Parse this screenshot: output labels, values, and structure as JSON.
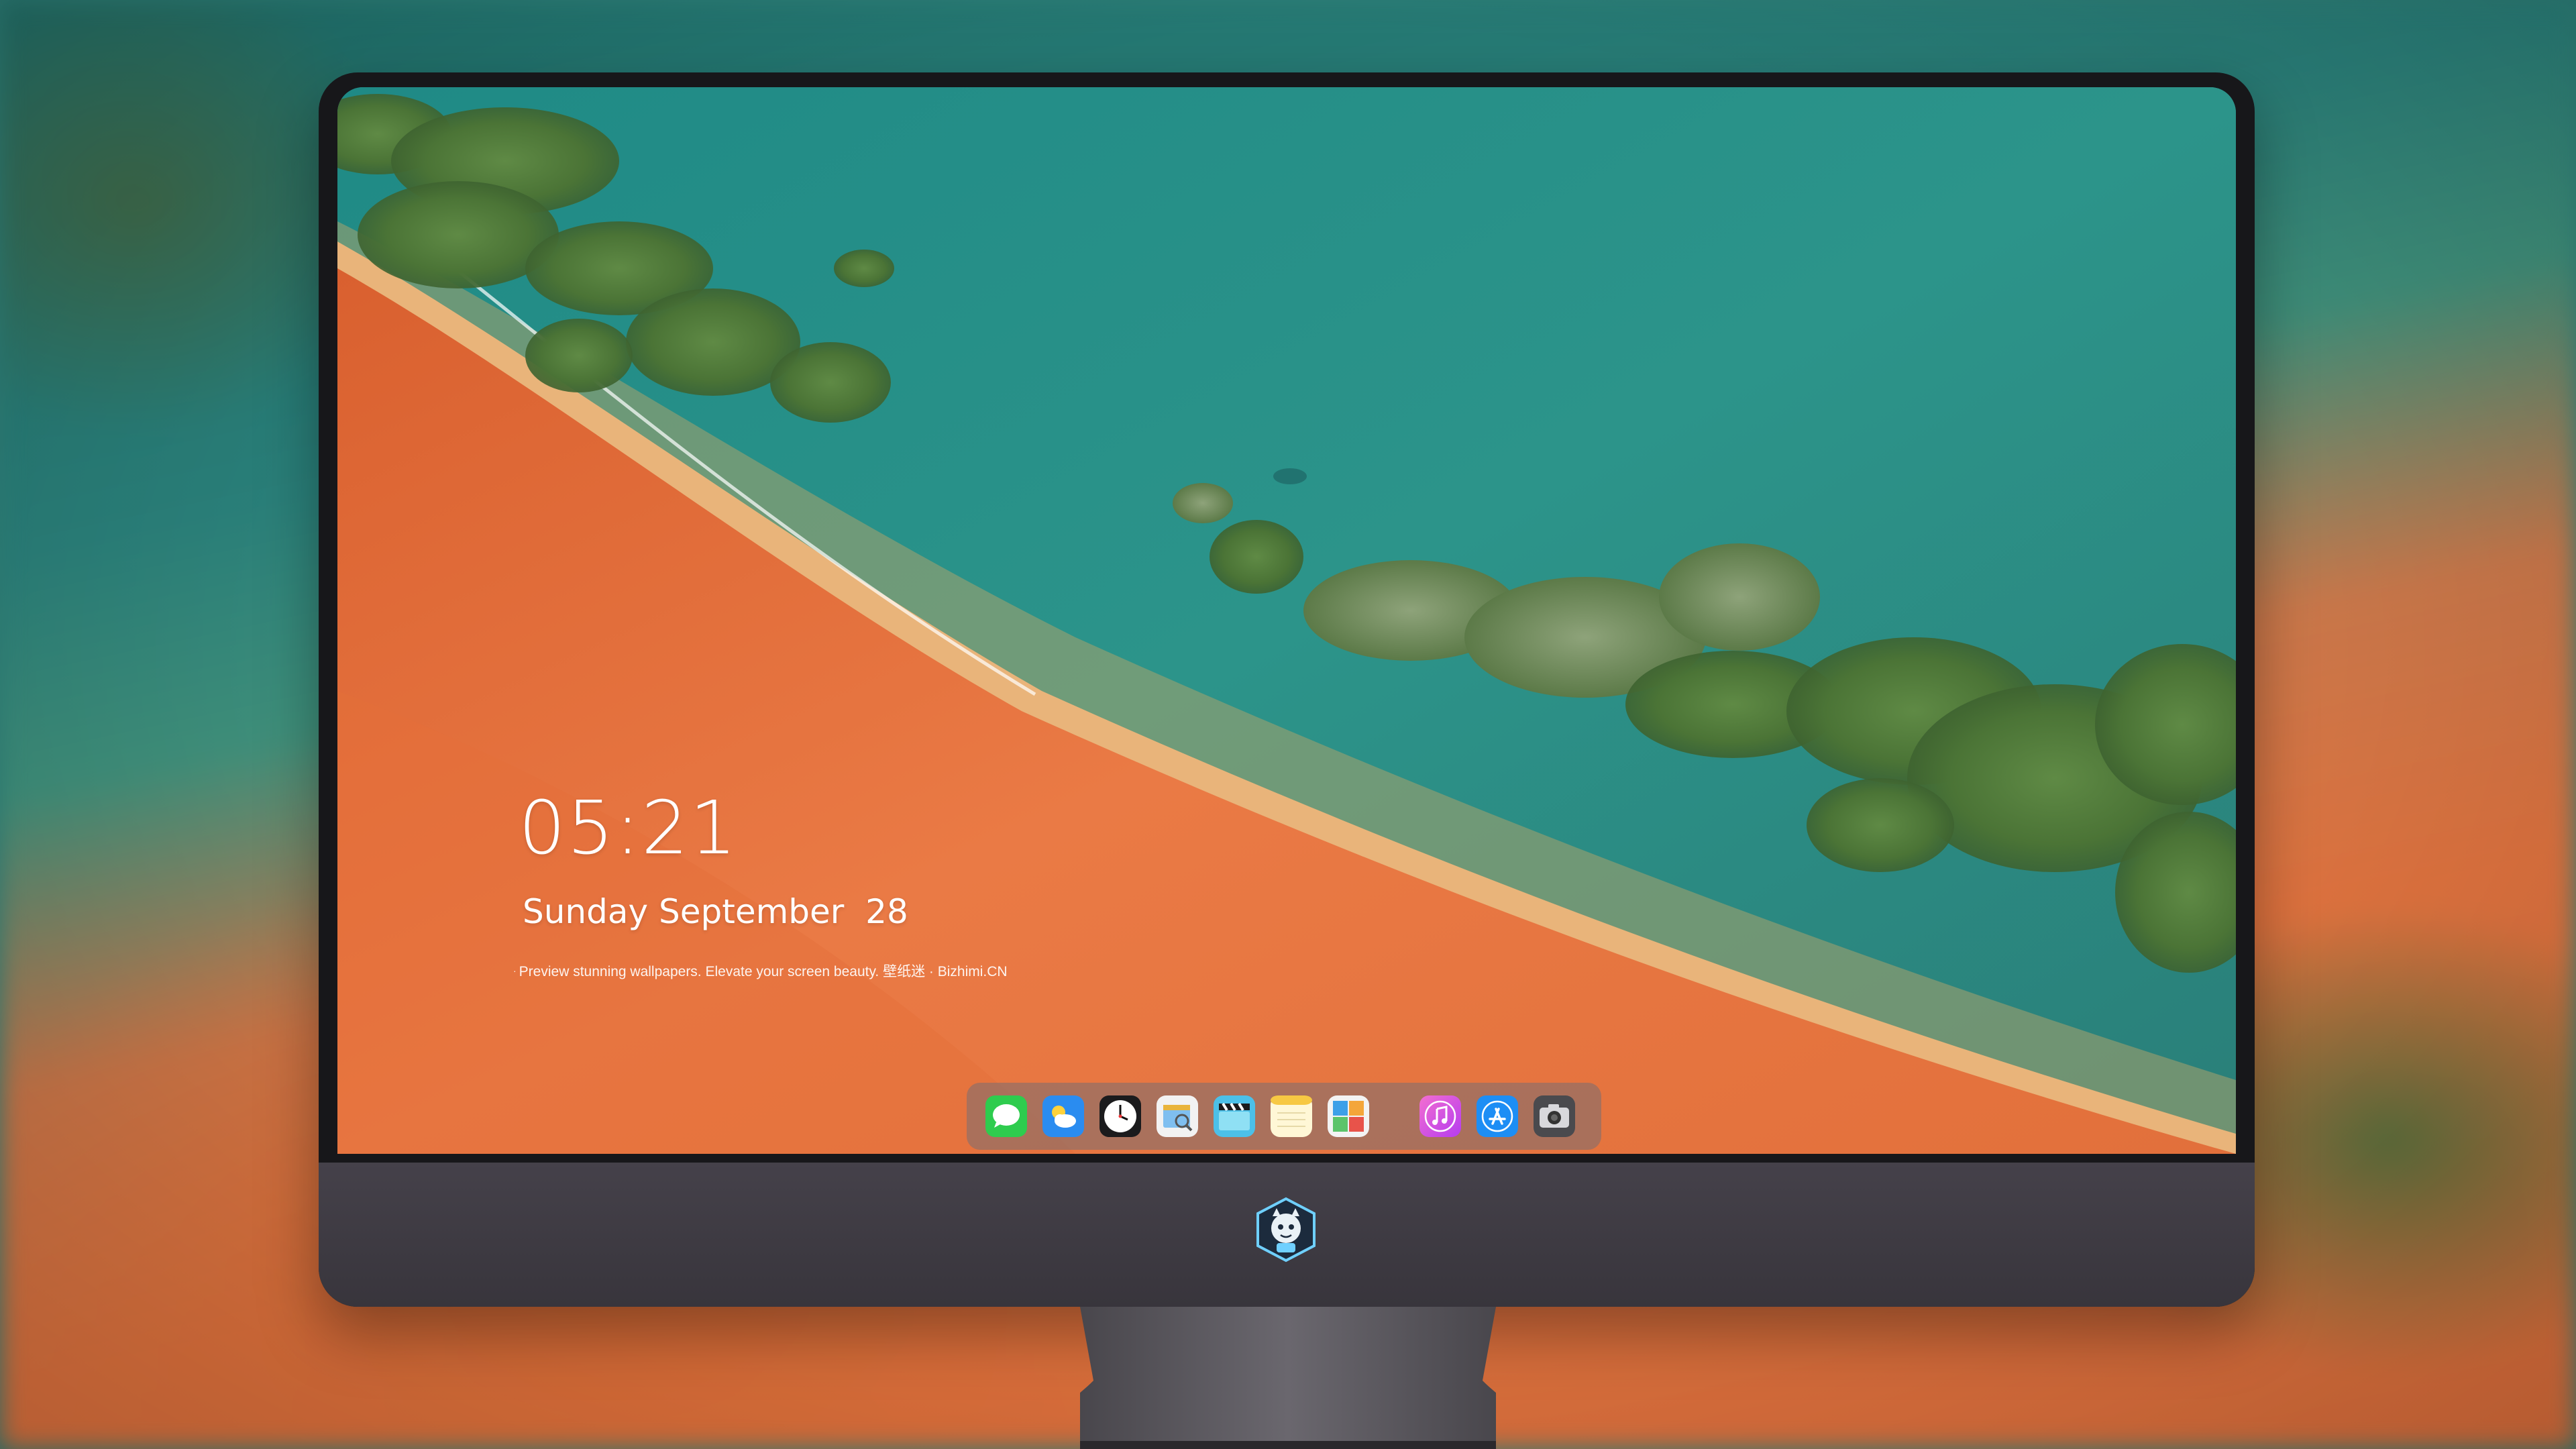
{
  "lockscreen": {
    "time": "05:21",
    "date": "Sunday September  28",
    "promo_text": "Preview stunning wallpapers. Elevate your screen beauty. 壁纸迷 · Bizhimi.CN"
  },
  "dock": {
    "apps": [
      {
        "name": "Messages",
        "icon": "messages-icon"
      },
      {
        "name": "Weather",
        "icon": "weather-icon"
      },
      {
        "name": "Clock",
        "icon": "clock-icon"
      },
      {
        "name": "Preview",
        "icon": "preview-icon"
      },
      {
        "name": "Clips",
        "icon": "clapper-icon"
      },
      {
        "name": "Notes",
        "icon": "notes-icon"
      },
      {
        "name": "Photo Booth",
        "icon": "photo-booth-icon"
      }
    ],
    "apps_right": [
      {
        "name": "iTunes",
        "icon": "music-icon"
      },
      {
        "name": "App Store",
        "icon": "app-store-icon"
      },
      {
        "name": "Camera",
        "icon": "camera-icon"
      }
    ]
  },
  "monitor": {
    "logo": "mascot-logo"
  },
  "colors": {
    "sea": "#2b8a80",
    "sand": "#e06d3b",
    "bezel": "#17171a",
    "chin": "#3f3b43"
  }
}
